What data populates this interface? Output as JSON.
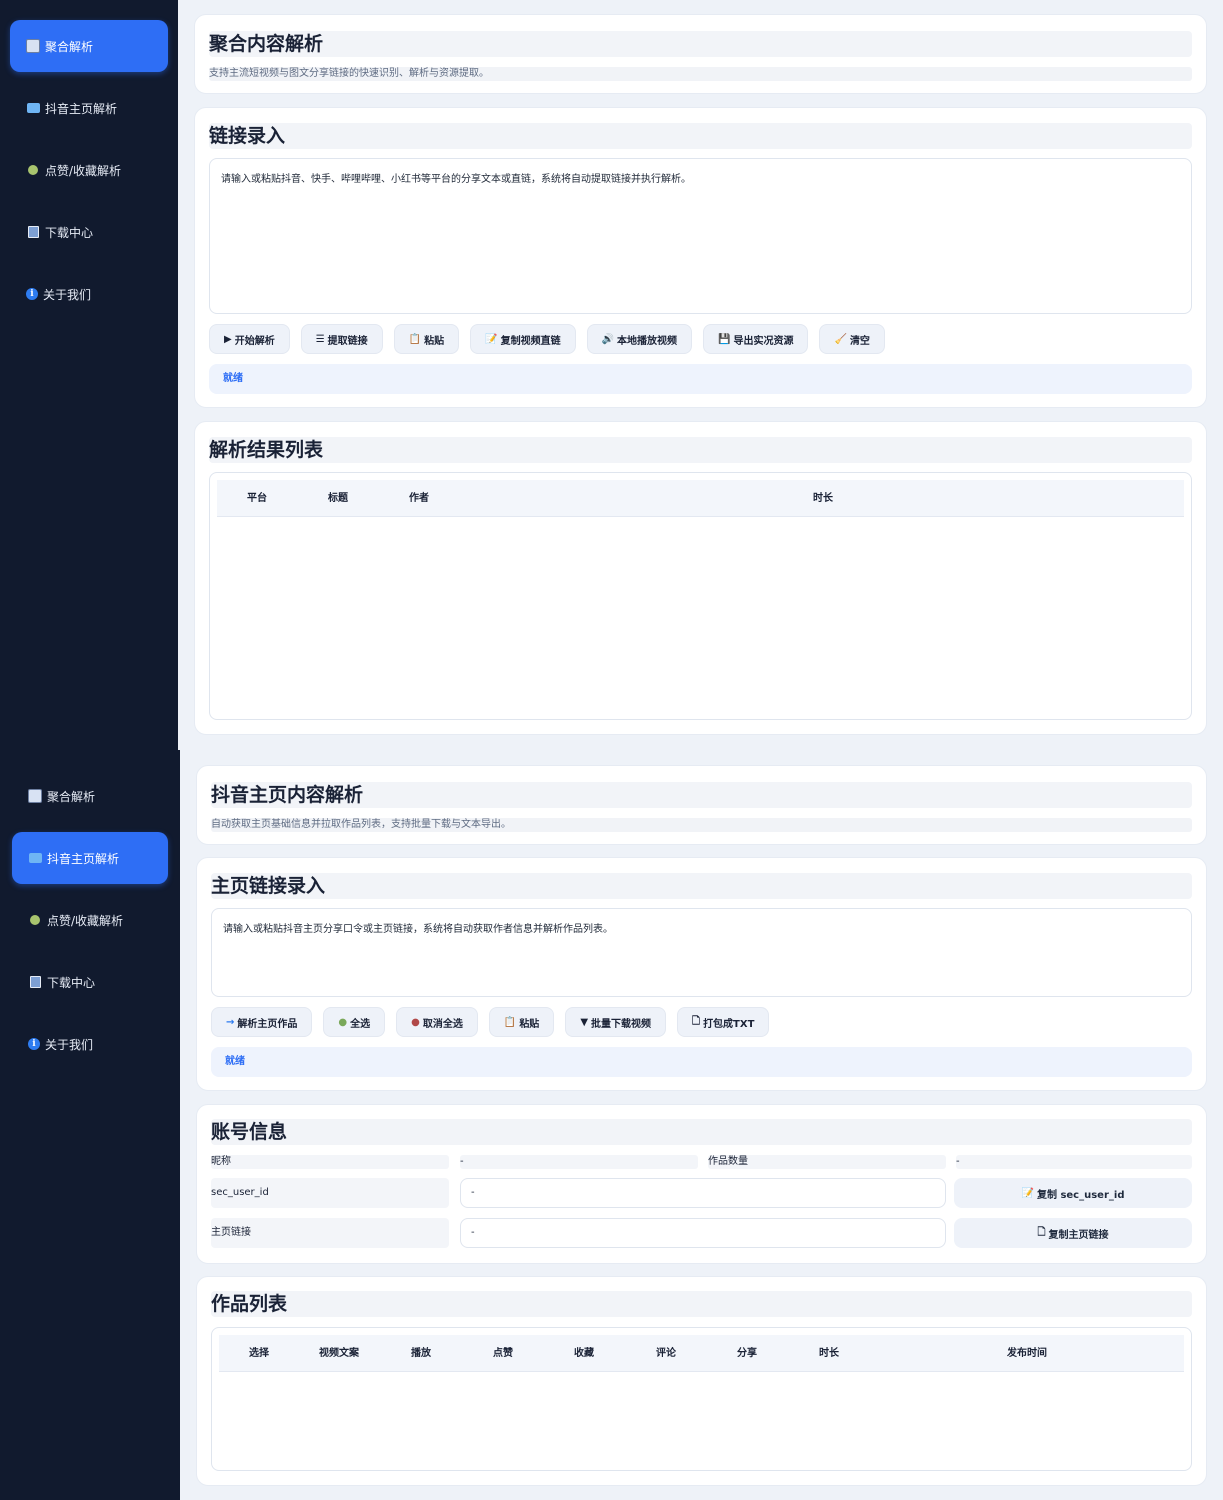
{
  "screen1": {
    "sidebar": {
      "items": [
        {
          "label": "聚合解析",
          "icon": "document-icon",
          "active": true
        },
        {
          "label": "抖音主页解析",
          "icon": "folder-icon",
          "active": false
        },
        {
          "label": "点赞/收藏解析",
          "icon": "dot-icon",
          "active": false
        },
        {
          "label": "下载中心",
          "icon": "save-icon",
          "active": false
        },
        {
          "label": "关于我们",
          "icon": "info-icon",
          "active": false
        }
      ]
    },
    "header": {
      "title": "聚合内容解析",
      "subtitle": "支持主流短视频与图文分享链接的快速识别、解析与资源提取。"
    },
    "input_card": {
      "title": "链接录入",
      "placeholder": "请输入或粘贴抖音、快手、哔哩哔哩、小红书等平台的分享文本或直链，系统将自动提取链接并执行解析。",
      "buttons": [
        {
          "icon": "▶",
          "label": "开始解析"
        },
        {
          "icon": "☰",
          "label": "提取链接"
        },
        {
          "icon": "📋",
          "label": "粘贴"
        },
        {
          "icon": "📝",
          "label": "复制视频直链"
        },
        {
          "icon": "🔊",
          "label": "本地播放视频"
        },
        {
          "icon": "💾",
          "label": "导出实况资源"
        },
        {
          "icon": "🧹",
          "label": "清空"
        }
      ],
      "status": "就绪"
    },
    "results_card": {
      "title": "解析结果列表",
      "columns": [
        "平台",
        "标题",
        "作者",
        "时长"
      ]
    }
  },
  "screen2": {
    "sidebar": {
      "items": [
        {
          "label": "聚合解析",
          "icon": "document-icon",
          "active": false
        },
        {
          "label": "抖音主页解析",
          "icon": "folder-icon",
          "active": true
        },
        {
          "label": "点赞/收藏解析",
          "icon": "dot-icon",
          "active": false
        },
        {
          "label": "下载中心",
          "icon": "save-icon",
          "active": false
        },
        {
          "label": "关于我们",
          "icon": "info-icon",
          "active": false
        }
      ]
    },
    "header": {
      "title": "抖音主页内容解析",
      "subtitle": "自动获取主页基础信息并拉取作品列表，支持批量下载与文本导出。"
    },
    "input_card": {
      "title": "主页链接录入",
      "placeholder": "请输入或粘贴抖音主页分享口令或主页链接，系统将自动获取作者信息并解析作品列表。",
      "buttons": [
        {
          "icon": "→",
          "label": "解析主页作品"
        },
        {
          "icon": "●",
          "label": "全选"
        },
        {
          "icon": "●",
          "label": "取消全选"
        },
        {
          "icon": "📋",
          "label": "粘贴"
        },
        {
          "icon": "▼",
          "label": "批量下载视频"
        },
        {
          "icon": "🗋",
          "label": "打包成TXT"
        }
      ],
      "status": "就绪"
    },
    "account_card": {
      "title": "账号信息",
      "nickname_label": "昵称",
      "nickname_value": "-",
      "works_label": "作品数量",
      "works_value": "-",
      "sec_user_id_label": "sec_user_id",
      "sec_user_id_value": "-",
      "copy_sec_label": "复制 sec_user_id",
      "homepage_label": "主页链接",
      "homepage_value": "-",
      "copy_home_label": "复制主页链接"
    },
    "works_card": {
      "title": "作品列表",
      "columns": [
        "选择",
        "视频文案",
        "播放",
        "点赞",
        "收藏",
        "评论",
        "分享",
        "时长",
        "发布时间"
      ]
    }
  },
  "colors": {
    "sidebar_bg": "#111a2e",
    "accent": "#2e6ef5",
    "page_bg": "#eef2f8"
  }
}
